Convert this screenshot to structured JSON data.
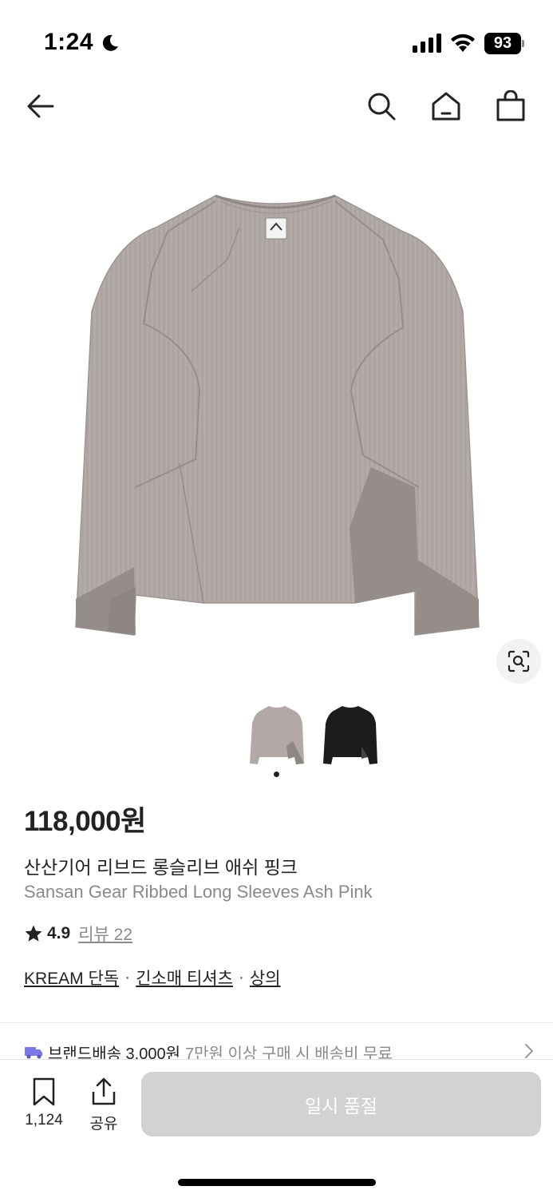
{
  "status_bar": {
    "time": "1:24",
    "battery": "93"
  },
  "nav": {
    "back_icon": "arrow-left-icon",
    "search_icon": "search-icon",
    "home_icon": "home-icon",
    "cart_icon": "shopping-bag-icon"
  },
  "product": {
    "price": "118,000원",
    "name_ko": "산산기어 리브드 롱슬리브 애쉬 핑크",
    "name_en": "Sansan Gear Ribbed Long Sleeves Ash Pink",
    "rating": "4.9",
    "review_label": "리뷰 22",
    "colors": [
      "#b2a9a6",
      "#1c1c1c"
    ]
  },
  "breadcrumbs": {
    "items": [
      "KREAM 단독",
      "긴소매 티셔츠",
      "상의"
    ],
    "separator": "·"
  },
  "shipping": {
    "title": "브랜드배송 3,000원",
    "desc": "7만원 이상 구매 시 배송비 무료"
  },
  "bottom_bar": {
    "bookmark_count": "1,124",
    "share_label": "공유",
    "cta_label": "일시 품절"
  },
  "colors": {
    "accent_truck": "#7a77e6",
    "disabled_button": "#d2d2d2"
  }
}
